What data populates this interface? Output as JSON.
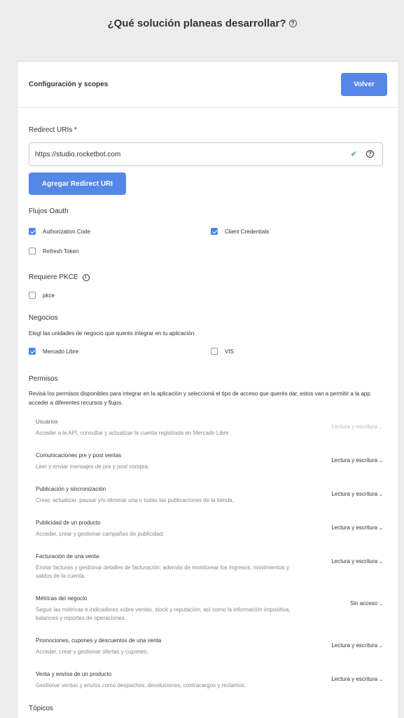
{
  "page": {
    "title": "¿Qué solución planeas desarrollar?"
  },
  "card": {
    "title": "Configuración y scopes",
    "back_label": "Volver"
  },
  "redirect": {
    "label": "Redirect URIs *",
    "value": "https://studio.rocketbot.com",
    "add_label": "Agregar Redirect URI"
  },
  "oauth": {
    "label": "Flujos Oauth",
    "options": [
      {
        "label": "Authorization Code",
        "checked": true
      },
      {
        "label": "Client Credentials",
        "checked": true
      },
      {
        "label": "Refresh Token",
        "checked": false
      }
    ]
  },
  "pkce": {
    "label": "Requiere PKCE",
    "option": {
      "label": "pkce",
      "checked": false
    }
  },
  "negocios": {
    "label": "Negocios",
    "description": "Elegí las unidades de negocio que querés integrar en tu aplicación.",
    "options": [
      {
        "label": "Mercado Libre",
        "checked": true
      },
      {
        "label": "VIS",
        "checked": false
      }
    ]
  },
  "permisos": {
    "label": "Permisos",
    "description": "Revisá los permisos disponibles para integrar en la aplicación y seleccioná el tipo de acceso que querés dar, estos van a permitir a la app acceder a diferentes recursos y flujos.",
    "items": [
      {
        "title": "Usuarios",
        "desc": "Acceder a la API, consultar y actualizar la cuenta registrada en Mercado Libre.",
        "access": "Lectura y escritura",
        "disabled": true
      },
      {
        "title": "Comunicaciones pre y post ventas",
        "desc": "Leer y enviar mensajes de pre y post compra.",
        "access": "Lectura y escritura",
        "disabled": false
      },
      {
        "title": "Publicación y sincronización",
        "desc": "Crear, actualizar, pausar y/o eliminar una o todas las publicaciones de la tienda.",
        "access": "Lectura y escritura",
        "disabled": false
      },
      {
        "title": "Publicidad de un producto",
        "desc": "Acceder, crear y gestionar campañas de publicidad.",
        "access": "Lectura y escritura",
        "disabled": false
      },
      {
        "title": "Facturación de una venta",
        "desc": "Enviar facturas y gestionar detalles de facturación, además de monitorear los ingresos, movimientos y saldos de la cuenta.",
        "access": "Lectura y escritura",
        "disabled": false
      },
      {
        "title": "Métricas del negocio",
        "desc": "Seguir las métricas e indicadores sobre ventas, stock y reputación, así como la información impositiva, balances y reportes de operaciones.",
        "access": "Sin acceso",
        "disabled": false
      },
      {
        "title": "Promociones, cupones y descuentos de una venta",
        "desc": "Acceder, crear y gestionar ofertas y cupones.",
        "access": "Lectura y escritura",
        "disabled": false
      },
      {
        "title": "Venta y envíos de un producto",
        "desc": "Gestionar ventas y envíos como despachos, devoluciones, contracargos y reclamos.",
        "access": "Lectura y escritura",
        "disabled": false
      }
    ]
  },
  "topicos": {
    "label": "Tópicos"
  }
}
